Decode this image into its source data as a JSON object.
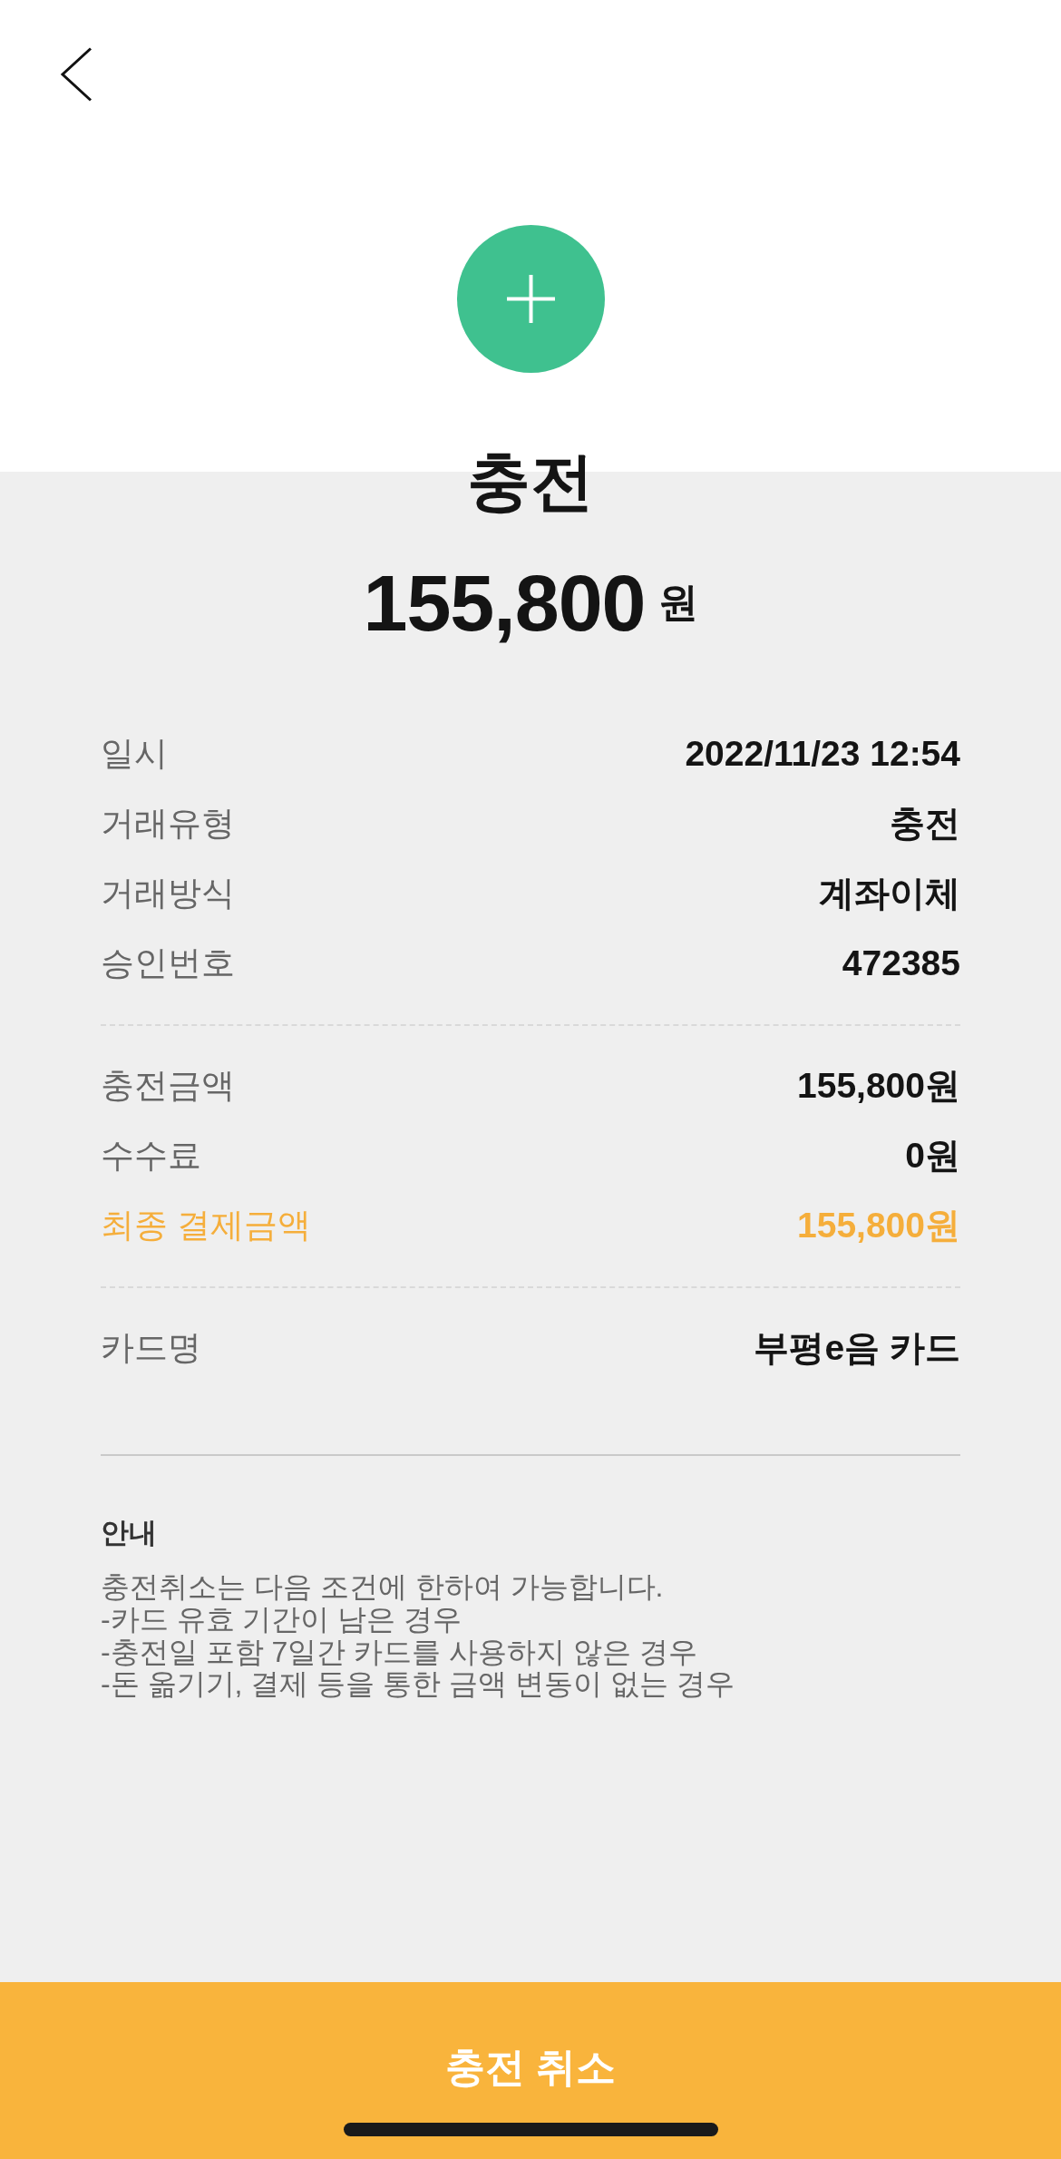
{
  "summary": {
    "title": "충전",
    "amount": "155,800",
    "currency": "원"
  },
  "detail_groups": [
    {
      "rows": [
        {
          "label": "일시",
          "value": "2022/11/23 12:54",
          "highlighted": false
        },
        {
          "label": "거래유형",
          "value": "충전",
          "highlighted": false
        },
        {
          "label": "거래방식",
          "value": "계좌이체",
          "highlighted": false
        },
        {
          "label": "승인번호",
          "value": "472385",
          "highlighted": false
        }
      ]
    },
    {
      "rows": [
        {
          "label": "충전금액",
          "value": "155,800원",
          "highlighted": false
        },
        {
          "label": "수수료",
          "value": "0원",
          "highlighted": false
        },
        {
          "label": "최종 결제금액",
          "value": "155,800원",
          "highlighted": true
        }
      ]
    },
    {
      "rows": [
        {
          "label": "카드명",
          "value": "부평e음 카드",
          "highlighted": false
        }
      ]
    }
  ],
  "notice": {
    "title": "안내",
    "lines": [
      "충전취소는 다음 조건에 한하여 가능합니다.",
      "-카드 유효 기간이 남은 경우",
      "-충전일 포함 7일간 카드를 사용하지 않은 경우",
      "-돈 옮기기, 결제 등을 통한 금액 변동이 없는 경우"
    ]
  },
  "cancel_button": {
    "label": "충전 취소"
  }
}
